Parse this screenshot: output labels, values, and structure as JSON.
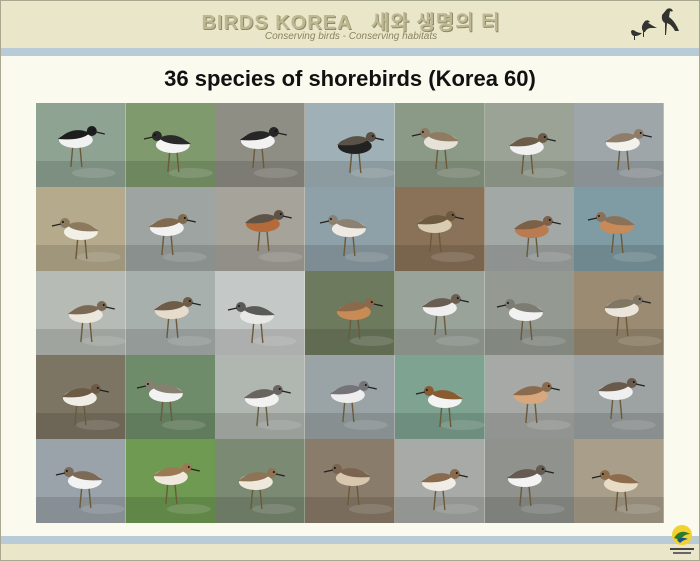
{
  "header": {
    "brand_latin": "BIRDS KOREA",
    "brand_korean": "새와 생명의 터",
    "tagline": "Conserving birds - Conserving habitats"
  },
  "slide": {
    "title": "36 species of shorebirds (Korea 60)"
  },
  "footer": {
    "logo_text": "새와 생명의 터 BIRDS KOREA"
  },
  "photos": [
    {
      "icon": "shorebird-photo",
      "bg": "#8fa393",
      "body": "#1d1d1d",
      "belly": "#f1f1f1"
    },
    {
      "icon": "shorebird-photo",
      "bg": "#7f9a6c",
      "body": "#2a2a2a",
      "belly": "#f4f4f4"
    },
    {
      "icon": "shorebird-photo",
      "bg": "#8f8e84",
      "body": "#262626",
      "belly": "#f2f2f2"
    },
    {
      "icon": "shorebird-photo",
      "bg": "#9fb1b6",
      "body": "#5a5246",
      "belly": "#222222"
    },
    {
      "icon": "shorebird-photo",
      "bg": "#8b9a86",
      "body": "#8e7b62",
      "belly": "#e7e2d8"
    },
    {
      "icon": "shorebird-photo",
      "bg": "#9aa396",
      "body": "#6d5c47",
      "belly": "#f1f1f1"
    },
    {
      "icon": "shorebird-photo",
      "bg": "#9ea6aa",
      "body": "#8d7d69",
      "belly": "#f3f1ec"
    },
    {
      "icon": "shorebird-photo",
      "bg": "#b5ab8c",
      "body": "#8c7a5f",
      "belly": "#f2efe7"
    },
    {
      "icon": "shorebird-photo",
      "bg": "#9da4a1",
      "body": "#7f6a50",
      "belly": "#f1f1f1"
    },
    {
      "icon": "shorebird-photo",
      "bg": "#a6a39a",
      "body": "#5e5346",
      "belly": "#b56a3a"
    },
    {
      "icon": "shorebird-photo",
      "bg": "#8fa1a8",
      "body": "#8c8070",
      "belly": "#eeeae3"
    },
    {
      "icon": "shorebird-photo",
      "bg": "#8a7259",
      "body": "#6e5a3e",
      "belly": "#d8ccb2"
    },
    {
      "icon": "shorebird-photo",
      "bg": "#a2a8a6",
      "body": "#7d6048",
      "belly": "#b97b4f"
    },
    {
      "icon": "shorebird-photo",
      "bg": "#7f9ba4",
      "body": "#8a7258",
      "belly": "#c98a5a"
    },
    {
      "icon": "shorebird-photo",
      "bg": "#b7bbb6",
      "body": "#7a6a55",
      "belly": "#ece7dc"
    },
    {
      "icon": "shorebird-photo",
      "bg": "#a8b0ad",
      "body": "#6e5b48",
      "belly": "#e6dccb"
    },
    {
      "icon": "shorebird-photo",
      "bg": "#c4c8c6",
      "body": "#5a5a58",
      "belly": "#e8e8e6"
    },
    {
      "icon": "shorebird-photo",
      "bg": "#6e7a5e",
      "body": "#8a6a4a",
      "belly": "#c98b55"
    },
    {
      "icon": "shorebird-photo",
      "bg": "#9aa39a",
      "body": "#6a5e52",
      "belly": "#efefef"
    },
    {
      "icon": "shorebird-photo",
      "bg": "#949a92",
      "body": "#7c7c72",
      "belly": "#f1f1f1"
    },
    {
      "icon": "shorebird-photo",
      "bg": "#9a8b72",
      "body": "#807664",
      "belly": "#ebe6dc"
    },
    {
      "icon": "shorebird-photo",
      "bg": "#7d7564",
      "body": "#6d5a45",
      "belly": "#f0ede6"
    },
    {
      "icon": "shorebird-photo",
      "bg": "#6f8c6a",
      "body": "#858070",
      "belly": "#f2f2f2"
    },
    {
      "icon": "shorebird-photo",
      "bg": "#b0b6b0",
      "body": "#6a6460",
      "belly": "#f2f2f2"
    },
    {
      "icon": "shorebird-photo",
      "bg": "#9aa3a6",
      "body": "#747478",
      "belly": "#eeeeee"
    },
    {
      "icon": "shorebird-photo",
      "bg": "#7ea391",
      "body": "#8a5a30",
      "belly": "#f3f3f3"
    },
    {
      "icon": "shorebird-photo",
      "bg": "#a6a9a5",
      "body": "#8a6b4e",
      "belly": "#d9a77c"
    },
    {
      "icon": "shorebird-photo",
      "bg": "#9da3a2",
      "body": "#6a5a4c",
      "belly": "#efefef"
    },
    {
      "icon": "shorebird-photo",
      "bg": "#9aa3a9",
      "body": "#7c6a56",
      "belly": "#f2f2f2"
    },
    {
      "icon": "shorebird-photo",
      "bg": "#6f9a52",
      "body": "#9a7a52",
      "belly": "#efe8dc"
    },
    {
      "icon": "shorebird-photo",
      "bg": "#7b8a72",
      "body": "#8c7454",
      "belly": "#efe9dc"
    },
    {
      "icon": "shorebird-photo",
      "bg": "#8a7c6a",
      "body": "#7a6450",
      "belly": "#d8c7ae"
    },
    {
      "icon": "shorebird-photo",
      "bg": "#a7aaa6",
      "body": "#8a6a4c",
      "belly": "#f1ede6"
    },
    {
      "icon": "shorebird-photo",
      "bg": "#8f928d",
      "body": "#655b52",
      "belly": "#f3f3f3"
    },
    {
      "icon": "shorebird-photo",
      "bg": "#a89e8a",
      "body": "#8c6c4a",
      "belly": "#e9dcc6"
    }
  ]
}
